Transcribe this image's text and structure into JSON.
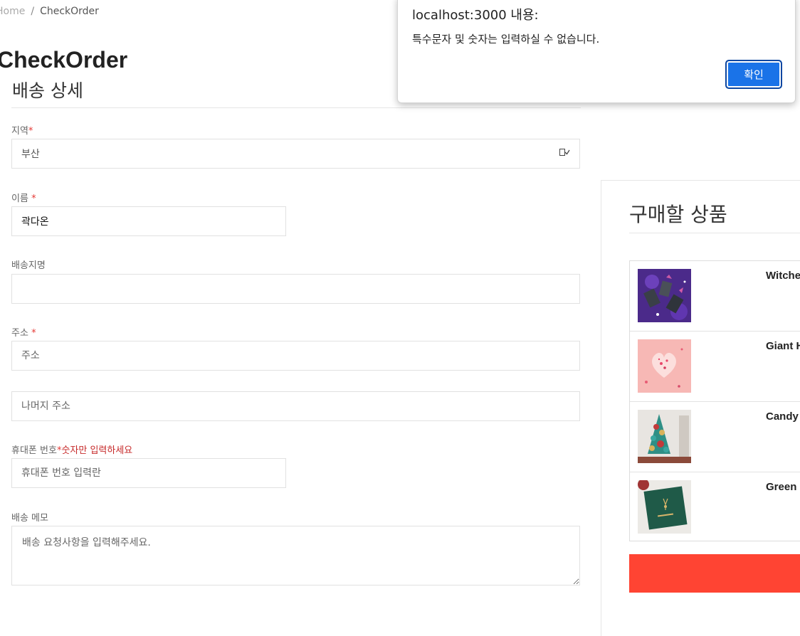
{
  "breadcrumb": {
    "home": "Home",
    "separator": "/",
    "current": "CheckOrder"
  },
  "page_title": "CheckOrder",
  "shipping": {
    "section_title": "배송 상세",
    "region": {
      "label": "지역",
      "required_mark": "*",
      "value": "부산"
    },
    "name": {
      "label": "이름 ",
      "required_mark": "*",
      "value": "곽다온"
    },
    "destination_name": {
      "label": "배송지명",
      "value": ""
    },
    "address": {
      "label": "주소 ",
      "required_mark": "*",
      "placeholder": "주소",
      "detail_placeholder": "나머지 주소"
    },
    "phone": {
      "label": "휴대폰 번호",
      "required_mark": "*",
      "hint": "숫자만 입력하세요",
      "placeholder": "휴대폰 번호 입력란"
    },
    "memo": {
      "label": "배송 메모",
      "placeholder": "배송 요청사항을 입력해주세요."
    }
  },
  "summary": {
    "title": "구매할 상품",
    "products": [
      {
        "name": "Witche",
        "thumb_icon": "witch-cups-photo"
      },
      {
        "name": "Giant H",
        "thumb_icon": "heart-balloon-photo"
      },
      {
        "name": "Candy",
        "thumb_icon": "christmas-tree-photo"
      },
      {
        "name": "Green I",
        "thumb_icon": "green-card-photo"
      }
    ]
  },
  "dialog": {
    "origin": "localhost:3000 내용:",
    "message": "특수문자 및 숫자는 입력하실 수 없습니다.",
    "ok_label": "확인"
  },
  "colors": {
    "accent_red": "#ff4433",
    "dialog_button": "#1a73e8"
  }
}
